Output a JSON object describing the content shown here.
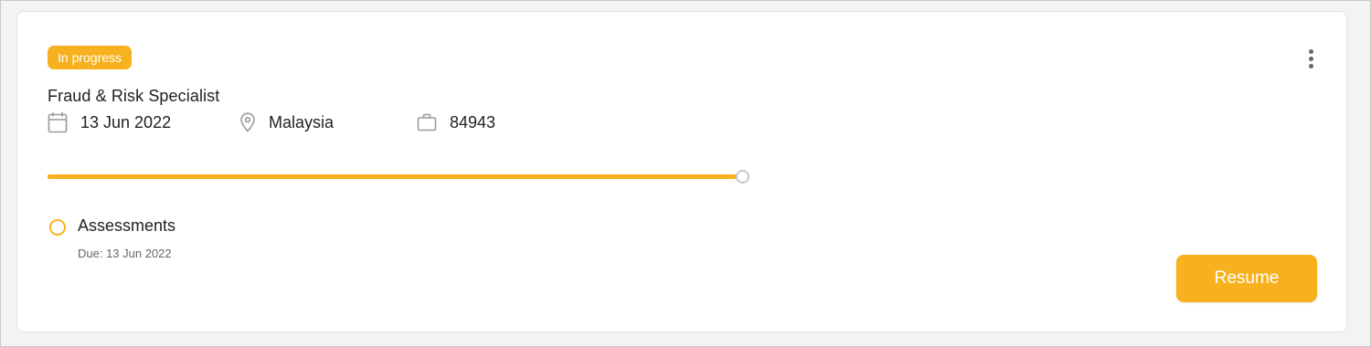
{
  "job": {
    "status_badge": "In progress",
    "title": "Fraud & Risk Specialist",
    "meta": {
      "date": "13 Jun 2022",
      "location": "Malaysia",
      "job_id": "84943"
    },
    "progress": 1.0
  },
  "steps": [
    {
      "label": "Assessments",
      "due": "Due: 13 Jun 2022"
    }
  ],
  "actions": {
    "resume_label": "Resume"
  },
  "colors": {
    "accent": "#f7b11e",
    "icon_gray": "#9a9a9a"
  },
  "icons": {
    "date": "calendar-icon",
    "location": "location-pin-icon",
    "job_id": "briefcase-icon",
    "menu": "more-vertical-icon"
  }
}
